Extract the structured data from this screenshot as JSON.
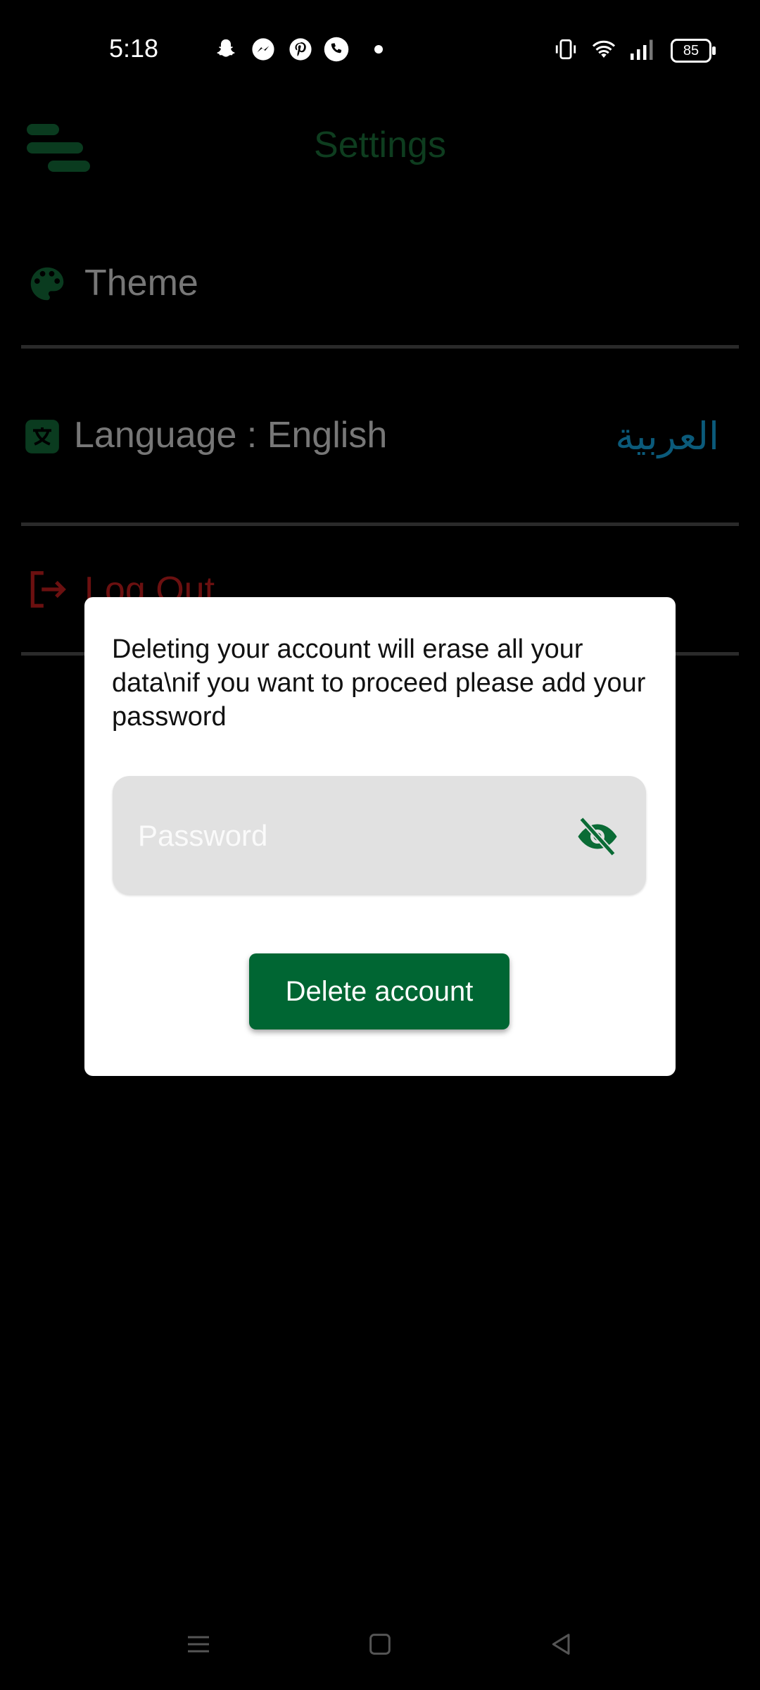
{
  "status_bar": {
    "time": "5:18",
    "notification_icons": [
      "snapchat-icon",
      "messenger-icon",
      "pinterest-icon",
      "phone-icon",
      "dot-icon"
    ],
    "system_icons": [
      "vibrate-icon",
      "wifi-icon",
      "signal-icon"
    ],
    "battery_level": "85"
  },
  "header": {
    "title": "Settings",
    "menu_icon": "menu-icon"
  },
  "settings": {
    "theme_label": "Theme",
    "language_label": "Language : English",
    "language_alt": "العربية",
    "logout_label": "Log Out"
  },
  "dialog": {
    "message": "Deleting your account will erase all your data\\nif you want to proceed please add your password",
    "password_placeholder": "Password",
    "password_value": "",
    "visibility_icon": "eye-off-icon",
    "delete_button_label": "Delete account"
  },
  "nav_bar": {
    "items": [
      "recents-icon",
      "home-icon",
      "back-icon"
    ]
  },
  "colors": {
    "accent": "#006633",
    "logout": "#6b1010",
    "arabic_link": "#0b5a7a"
  }
}
